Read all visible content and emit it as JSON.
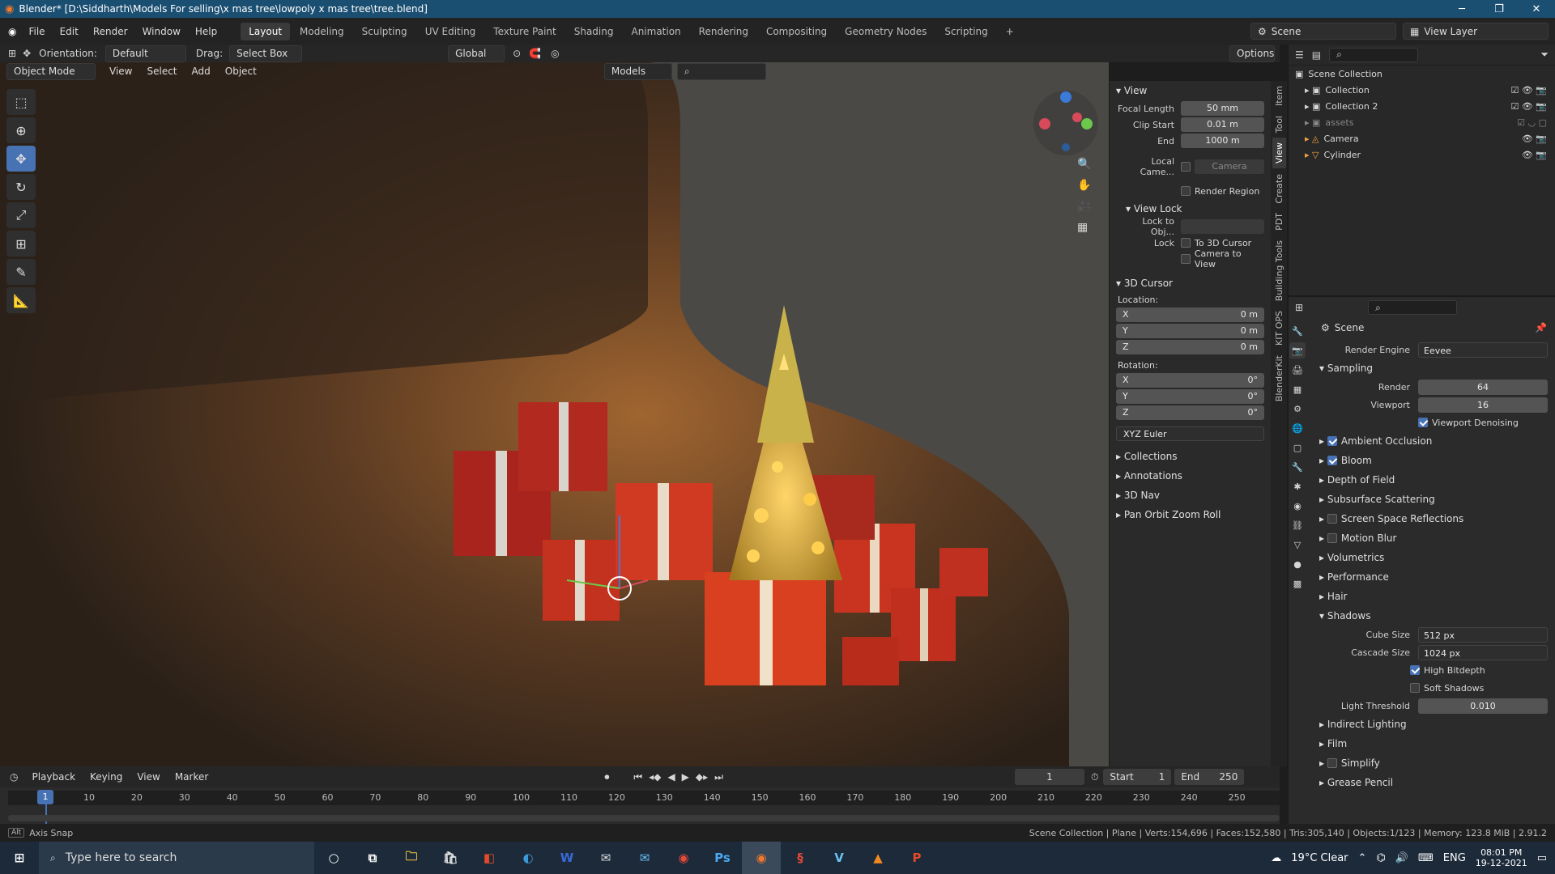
{
  "window": {
    "title": "Blender* [D:\\Siddharth\\Models For selling\\x mas tree\\lowpoly x mas tree\\tree.blend]",
    "minimize": "─",
    "maximize": "❐",
    "close": "✕"
  },
  "menu": {
    "items": [
      "File",
      "Edit",
      "Render",
      "Window",
      "Help"
    ],
    "workspaces": [
      "Layout",
      "Modeling",
      "Sculpting",
      "UV Editing",
      "Texture Paint",
      "Shading",
      "Animation",
      "Rendering",
      "Compositing",
      "Geometry Nodes",
      "Scripting"
    ],
    "add_tab": "+",
    "scene": "Scene",
    "view_layer": "View Layer"
  },
  "header3d": {
    "orientation_label": "Orientation:",
    "orientation": "Default",
    "drag_label": "Drag:",
    "drag": "Select Box",
    "transform": "Global",
    "options": "Options",
    "mode": "Object Mode",
    "menus": [
      "View",
      "Select",
      "Add",
      "Object"
    ],
    "models": "Models"
  },
  "npanel": {
    "view_title": "View",
    "focal_label": "Focal Length",
    "focal": "50 mm",
    "clip_start_label": "Clip Start",
    "clip_start": "0.01 m",
    "end_label": "End",
    "end": "1000 m",
    "local_cam_label": "Local Came...",
    "local_cam": "Camera",
    "render_region": "Render Region",
    "view_lock_title": "View Lock",
    "lock_obj_label": "Lock to Obj...",
    "lock_label": "Lock",
    "to_3d_cursor": "To 3D Cursor",
    "camera_to_view": "Camera to View",
    "cursor_title": "3D Cursor",
    "location_label": "Location:",
    "location": [
      {
        "axis": "X",
        "value": "0 m"
      },
      {
        "axis": "Y",
        "value": "0 m"
      },
      {
        "axis": "Z",
        "value": "0 m"
      }
    ],
    "rotation_label": "Rotation:",
    "rotation": [
      {
        "axis": "X",
        "value": "0°"
      },
      {
        "axis": "Y",
        "value": "0°"
      },
      {
        "axis": "Z",
        "value": "0°"
      }
    ],
    "rotation_mode": "XYZ Euler",
    "collapsed": [
      "Collections",
      "Annotations",
      "3D Nav",
      "Pan Orbit Zoom Roll"
    ]
  },
  "vtabs": [
    "Item",
    "Tool",
    "View",
    "Create",
    "PDT",
    "Building Tools",
    "KIT OPS",
    "BlenderKit"
  ],
  "outliner": {
    "root": "Scene Collection",
    "rows": [
      "Collection",
      "Collection 2",
      "assets",
      "Camera",
      "Cylinder"
    ]
  },
  "properties": {
    "scene": "Scene",
    "render_engine_label": "Render Engine",
    "render_engine": "Eevee",
    "sampling": "Sampling",
    "render_label": "Render",
    "render": "64",
    "viewport_label": "Viewport",
    "viewport": "16",
    "viewport_denoising": "Viewport Denoising",
    "sections": [
      {
        "label": "Ambient Occlusion",
        "checked": true
      },
      {
        "label": "Bloom",
        "checked": true
      },
      {
        "label": "Depth of Field",
        "checked": null
      },
      {
        "label": "Subsurface Scattering",
        "checked": null
      },
      {
        "label": "Screen Space Reflections",
        "checked": false
      },
      {
        "label": "Motion Blur",
        "checked": false
      },
      {
        "label": "Volumetrics",
        "checked": null
      },
      {
        "label": "Performance",
        "checked": null
      },
      {
        "label": "Hair",
        "checked": null
      }
    ],
    "shadows": "Shadows",
    "cube_size_label": "Cube Size",
    "cube_size": "512 px",
    "cascade_size_label": "Cascade Size",
    "cascade_size": "1024 px",
    "high_bitdepth": "High Bitdepth",
    "soft_shadows": "Soft Shadows",
    "light_threshold_label": "Light Threshold",
    "light_threshold": "0.010",
    "more": [
      {
        "label": "Indirect Lighting",
        "checked": null
      },
      {
        "label": "Film",
        "checked": null
      },
      {
        "label": "Simplify",
        "checked": false
      },
      {
        "label": "Grease Pencil",
        "checked": null
      }
    ]
  },
  "timeline": {
    "menus": [
      "Playback",
      "Keying",
      "View",
      "Marker"
    ],
    "current": "1",
    "start_label": "Start",
    "start": "1",
    "end_label": "End",
    "end": "250",
    "ticks": [
      "10",
      "20",
      "30",
      "40",
      "50",
      "60",
      "70",
      "80",
      "90",
      "100",
      "110",
      "120",
      "130",
      "140",
      "150",
      "160",
      "170",
      "180",
      "190",
      "200",
      "210",
      "220",
      "230",
      "240",
      "250"
    ],
    "frame_marker": "1"
  },
  "status": {
    "left": "Axis Snap",
    "right": "Scene Collection | Plane | Verts:154,696 | Faces:152,580 | Tris:305,140 | Objects:1/123 | Memory: 123.8 MiB | 2.91.2"
  },
  "taskbar": {
    "search": "Type here to search",
    "weather": "19°C  Clear",
    "lang": "ENG",
    "time": "08:01 PM",
    "date": "19-12-2021"
  },
  "colors": {
    "accent": "#4772b3",
    "title": "#1b4f72"
  }
}
